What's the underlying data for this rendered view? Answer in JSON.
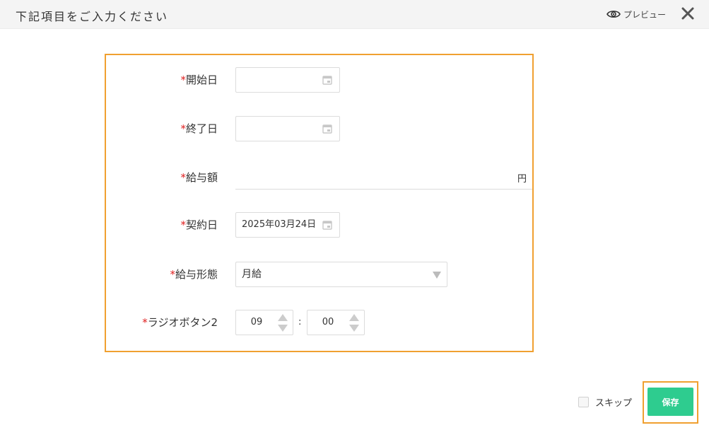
{
  "header": {
    "title": "下記項目をご入力ください",
    "preview_label": "プレビュー"
  },
  "form": {
    "required_mark": "*",
    "fields": [
      {
        "label": "開始日",
        "value": ""
      },
      {
        "label": "終了日",
        "value": ""
      },
      {
        "label": "給与額",
        "value": "",
        "unit": "円"
      },
      {
        "label": "契約日",
        "value": "2025年03月24日"
      },
      {
        "label": "給与形態",
        "value": "月給"
      },
      {
        "label": "ラジオボタン2",
        "hour": "09",
        "separator": ":",
        "minute": "00"
      }
    ]
  },
  "footer": {
    "skip_label": "スキップ",
    "save_label": "保存"
  },
  "colors": {
    "accent_border": "#f0a030",
    "save_button": "#2ecc8f",
    "required": "#e02020"
  }
}
